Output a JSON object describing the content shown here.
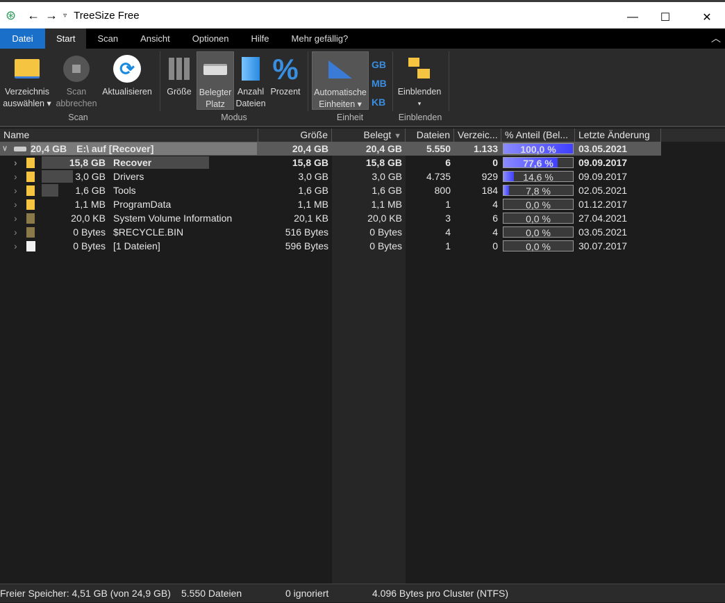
{
  "window": {
    "title": "TreeSize Free",
    "minimize": "—",
    "maximize": "☐",
    "close": "✕"
  },
  "tabs": [
    "Datei",
    "Start",
    "Scan",
    "Ansicht",
    "Optionen",
    "Hilfe",
    "Mehr gefällig?"
  ],
  "ribbon": {
    "buttons": [
      {
        "l1": "Verzeichnis",
        "l2": "auswählen ▾",
        "icon": "folder-icon"
      },
      {
        "l1": "Scan",
        "l2": "abbrechen",
        "icon": "stop-icon"
      },
      {
        "l1": "Aktualisieren",
        "l2": "",
        "icon": "refresh-icon"
      },
      {
        "l1": "Größe",
        "l2": "",
        "icon": "bars-icon"
      },
      {
        "l1": "Belegter",
        "l2": "Platz",
        "icon": "drive-icon"
      },
      {
        "l1": "Anzahl",
        "l2": "Dateien",
        "icon": "files-icon"
      },
      {
        "l1": "Prozent",
        "l2": "",
        "icon": "percent-icon"
      },
      {
        "l1": "Automatische",
        "l2": "Einheiten ▾",
        "icon": "ruler-icon"
      },
      {
        "l1": "Einblenden",
        "l2": "▾",
        "icon": "tree-folder-icon"
      }
    ],
    "units": [
      "GB",
      "MB",
      "KB"
    ],
    "groups": [
      "Scan",
      "Modus",
      "Einheit",
      "Einblenden"
    ]
  },
  "columns": [
    "Name",
    "Größe",
    "Belegt",
    "Dateien",
    "Verzeic...",
    "% Anteil (Bel...",
    "Letzte Änderung"
  ],
  "rows": [
    {
      "size": "20,4 GB",
      "name": "E:\\  auf  [Recover]",
      "groesse": "20,4 GB",
      "belegt": "20,4 GB",
      "dateien": "5.550",
      "verz": "1.133",
      "pct": 100.0,
      "pct_label": "100,0 %",
      "date": "03.05.2021",
      "bold": true,
      "type": "drive"
    },
    {
      "size": "15,8 GB",
      "name": "Recover",
      "groesse": "15,8 GB",
      "belegt": "15,8 GB",
      "dateien": "6",
      "verz": "0",
      "pct": 77.6,
      "pct_label": "77,6 %",
      "date": "09.09.2017",
      "bold": true,
      "type": "folder"
    },
    {
      "size": "3,0 GB",
      "name": "Drivers",
      "groesse": "3,0 GB",
      "belegt": "3,0 GB",
      "dateien": "4.735",
      "verz": "929",
      "pct": 14.6,
      "pct_label": "14,6 %",
      "date": "09.09.2017",
      "type": "folder"
    },
    {
      "size": "1,6 GB",
      "name": "Tools",
      "groesse": "1,6 GB",
      "belegt": "1,6 GB",
      "dateien": "800",
      "verz": "184",
      "pct": 7.8,
      "pct_label": "7,8 %",
      "date": "02.05.2021",
      "type": "folder"
    },
    {
      "size": "1,1 MB",
      "name": "ProgramData",
      "groesse": "1,1 MB",
      "belegt": "1,1 MB",
      "dateien": "1",
      "verz": "4",
      "pct": 0.0,
      "pct_label": "0,0 %",
      "date": "01.12.2017",
      "type": "folder"
    },
    {
      "size": "20,0 KB",
      "name": "System Volume Information",
      "groesse": "20,1 KB",
      "belegt": "20,0 KB",
      "dateien": "3",
      "verz": "6",
      "pct": 0.0,
      "pct_label": "0,0 %",
      "date": "27.04.2021",
      "type": "sysfolder"
    },
    {
      "size": "0 Bytes",
      "name": "$RECYCLE.BIN",
      "groesse": "516 Bytes",
      "belegt": "0 Bytes",
      "dateien": "4",
      "verz": "4",
      "pct": 0.0,
      "pct_label": "0,0 %",
      "date": "03.05.2021",
      "type": "sysfolder"
    },
    {
      "size": "0 Bytes",
      "name": "[1 Dateien]",
      "groesse": "596 Bytes",
      "belegt": "0 Bytes",
      "dateien": "1",
      "verz": "0",
      "pct": 0.0,
      "pct_label": "0,0 %",
      "date": "30.07.2017",
      "type": "file"
    }
  ],
  "status": {
    "free": "Freier Speicher: 4,51 GB  (von 24,9 GB)",
    "files": "5.550 Dateien",
    "ignored": "0 ignoriert",
    "cluster": "4.096 Bytes pro Cluster (NTFS)"
  },
  "colors": {
    "accent": "#1a6fc9",
    "bar": "#4040ff",
    "folder": "#f5c542"
  }
}
